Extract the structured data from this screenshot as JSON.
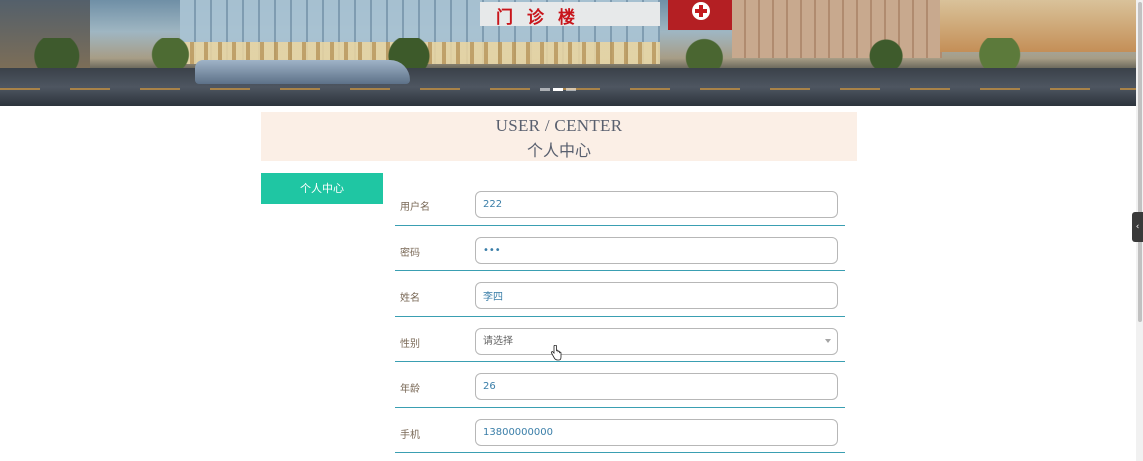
{
  "banner": {
    "sign_text": "门诊楼",
    "slides": 3,
    "active_slide": 2
  },
  "header": {
    "title_en": "USER / CENTER",
    "title_cn": "个人中心"
  },
  "sidebar": {
    "items": [
      {
        "label": "个人中心",
        "active": true
      }
    ]
  },
  "form": {
    "fields": [
      {
        "label": "用户名",
        "value": "222",
        "type": "text"
      },
      {
        "label": "密码",
        "value": "•••",
        "type": "password"
      },
      {
        "label": "姓名",
        "value": "李四",
        "type": "text"
      },
      {
        "label": "性别",
        "value": "请选择",
        "type": "select"
      },
      {
        "label": "年龄",
        "value": "26",
        "type": "text"
      },
      {
        "label": "手机",
        "value": "13800000000",
        "type": "text"
      }
    ]
  },
  "colors": {
    "accent": "#1fc6a3",
    "title_bg": "#fbefe6",
    "divider": "#3a9fb2",
    "label": "#7a6957",
    "input_text": "#3a7ea8"
  },
  "icons": {
    "banner_cross": "red-cross-icon",
    "select_arrow": "chevron-down-icon",
    "cursor": "hand-pointer-icon",
    "side_toggle": "chevron-left-icon"
  }
}
